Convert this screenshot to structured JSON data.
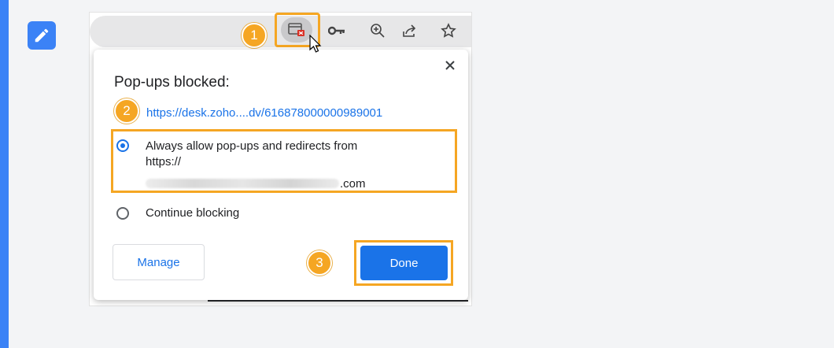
{
  "browser": {
    "toolbar_icons": [
      "popup-blocked-icon",
      "key-icon",
      "zoom-icon",
      "share-icon",
      "star-icon"
    ]
  },
  "steps": {
    "step1": "1",
    "step2": "2",
    "step3": "3"
  },
  "dialog": {
    "title": "Pop-ups blocked:",
    "close_label": "×",
    "link_text": "https://desk.zoho....dv/616878000000989001",
    "options": [
      {
        "label_line1": "Always allow pop-ups and redirects from",
        "label_line2": "https://",
        "label_line3": ".com",
        "selected": true
      },
      {
        "label_line1": "Continue blocking",
        "selected": false
      }
    ],
    "manage_label": "Manage",
    "done_label": "Done"
  },
  "colors": {
    "accent": "#1a73e8",
    "highlight": "#f5a623",
    "note_bar": "#3b82f6"
  }
}
